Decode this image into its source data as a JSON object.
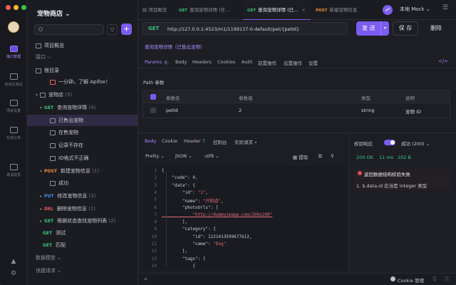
{
  "project": {
    "name": "宠物商店 ⌄"
  },
  "rail": {
    "items": [
      {
        "label": "接口管理",
        "active": true
      },
      {
        "label": "自动化测试"
      },
      {
        "label": "项目设置"
      },
      {
        "label": "在线分享"
      },
      {
        "label": "邀请成员"
      }
    ]
  },
  "sidebar": {
    "overview": "项目概览",
    "interfaces_label": "接口 ⌵",
    "root": "根目录",
    "promo": "一分钟，了解 Apifox！",
    "folder": "宠物店",
    "folder_count": "(5)",
    "items": [
      {
        "method": "GET",
        "label": "查询宠物详情",
        "count": "(4)"
      },
      {
        "label": "已售出宠物"
      },
      {
        "label": "在售宠物"
      },
      {
        "label": "记录不存在"
      },
      {
        "label": "ID格式不正确"
      },
      {
        "method": "POST",
        "label": "新建宠物信息",
        "count": "(1)"
      },
      {
        "label": "成功"
      },
      {
        "method": "PUT",
        "label": "修改宠物信息",
        "count": "(2)"
      },
      {
        "method": "DEL",
        "label": "删除宠物信息",
        "count": "(1)"
      },
      {
        "method": "GET",
        "label": "根据状态查找宠物列表",
        "count": "(2)"
      },
      {
        "method": "GET",
        "label": "测试"
      },
      {
        "method": "GET",
        "label": "匹配"
      }
    ],
    "data_models": "数据模型 ⌄",
    "shortcuts": "快捷请求 ⌄"
  },
  "tabs": [
    {
      "label": "项目概览"
    },
    {
      "method": "GET",
      "label": "查询宠物详情 (任..."
    },
    {
      "method": "GET",
      "label": "查询宠物详情 (已...",
      "active": true
    },
    {
      "method": "POST",
      "label": "新建宠物信息"
    }
  ],
  "environment": "本地 Mock ⌄",
  "request": {
    "method": "GET",
    "url": "http://127.0.0.1:4523/m1/1199137-0-default/pet/{petId}",
    "send": "发 送",
    "save": "保 存",
    "delete": "删除"
  },
  "api_name": "查询宠物详情（已售出宠物）",
  "subtabs": [
    {
      "label": "Params",
      "badge": "1",
      "active": true
    },
    {
      "label": "Body"
    },
    {
      "label": "Headers"
    },
    {
      "label": "Cookies"
    },
    {
      "label": "Auth"
    },
    {
      "label": "前置操作"
    },
    {
      "label": "后置操作"
    },
    {
      "label": "设置"
    }
  ],
  "path_params": {
    "title": "Path 参数",
    "headers": [
      "参数名",
      "参数值",
      "类型",
      "说明"
    ],
    "row": [
      "petId",
      "2",
      "string",
      "宠物 ID"
    ]
  },
  "response": {
    "tabs": [
      {
        "label": "Body",
        "active": true
      },
      {
        "label": "Cookie"
      },
      {
        "label": "Header",
        "badge": "7"
      },
      {
        "label": "控制台"
      },
      {
        "label": "实际请求 •"
      }
    ],
    "format": "Pretty ⌄",
    "lang": "JSON ⌄",
    "encoding": "utf8 ⌄",
    "copy": "提取",
    "code": [
      "{",
      "    \"code\": 0,",
      "    \"data\": {",
      "        \"id\": \"1\",",
      "        \"name\": \"只知道\",",
      "        \"photoUrls\": [",
      "            \"http://dummyimage.com/200x200\"",
      "        ],",
      "        \"category\": {",
      "            \"id\": 1221413599677612,",
      "            \"name\": \"Dog\"",
      "        },",
      "        \"tags\": [",
      "            {"
    ]
  },
  "validation": {
    "label": "校验响应",
    "result": "成功 (200) ⌄",
    "status": "200 OK",
    "time": "11 ms",
    "size": "202 B",
    "error_title": "返回数据结构校验失败",
    "error_detail": "1. $.data.id 应当是 integer 类型"
  },
  "footer": {
    "cookie": "Cookie 管理"
  }
}
